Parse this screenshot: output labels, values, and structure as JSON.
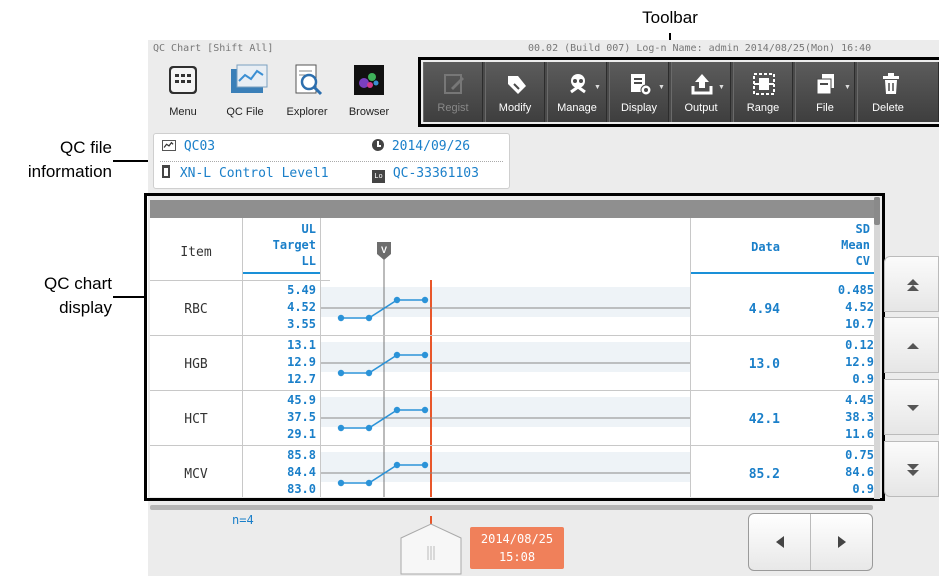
{
  "annotations": {
    "toolbar": "Toolbar",
    "qc_file_info_line1": "QC file",
    "qc_file_info_line2": "information",
    "qc_chart_line1": "QC chart",
    "qc_chart_line2": "display"
  },
  "titlebar": {
    "left": "QC Chart [Shift All]",
    "right": "00.02 (Build 007)  Log-n Name: admin   2014/08/25(Mon) 16:40"
  },
  "launch_buttons": [
    {
      "label": "Menu",
      "icon": "grid-menu-icon"
    },
    {
      "label": "QC File",
      "icon": "qc-file-icon"
    },
    {
      "label": "Explorer",
      "icon": "explorer-icon"
    },
    {
      "label": "Browser",
      "icon": "browser-icon"
    }
  ],
  "toolbar": [
    {
      "label": "Regist",
      "icon": "pencil-icon",
      "dropdown": false,
      "enabled": false
    },
    {
      "label": "Modify",
      "icon": "eraser-icon",
      "dropdown": false,
      "enabled": true
    },
    {
      "label": "Manage",
      "icon": "manage-icon",
      "dropdown": true,
      "enabled": true
    },
    {
      "label": "Display",
      "icon": "display-settings-icon",
      "dropdown": true,
      "enabled": true
    },
    {
      "label": "Output",
      "icon": "upload-icon",
      "dropdown": true,
      "enabled": true
    },
    {
      "label": "Range",
      "icon": "range-icon",
      "dropdown": false,
      "enabled": true
    },
    {
      "label": "File",
      "icon": "file-icon",
      "dropdown": true,
      "enabled": true
    },
    {
      "label": "Delete",
      "icon": "trash-icon",
      "dropdown": false,
      "enabled": true
    }
  ],
  "qc_info": {
    "file_name": "QC03",
    "date": "2014/09/26",
    "material": "XN-L Control Level1",
    "lot": "QC-33361103"
  },
  "table": {
    "header": {
      "item": "Item",
      "ul": "UL",
      "target": "Target",
      "ll": "LL",
      "marker": "V",
      "data": "Data",
      "sd": "SD",
      "mean": "Mean",
      "cv": "CV"
    },
    "rows": [
      {
        "item": "RBC",
        "ul": "5.49",
        "target": "4.52",
        "ll": "3.55",
        "data": "4.94",
        "sd": "0.485",
        "mean": "4.52",
        "cv": "10.7"
      },
      {
        "item": "HGB",
        "ul": "13.1",
        "target": "12.9",
        "ll": "12.7",
        "data": "13.0",
        "sd": "0.12",
        "mean": "12.9",
        "cv": "0.9"
      },
      {
        "item": "HCT",
        "ul": "45.9",
        "target": "37.5",
        "ll": "29.1",
        "data": "42.1",
        "sd": "4.45",
        "mean": "38.3",
        "cv": "11.6"
      },
      {
        "item": "MCV",
        "ul": "85.8",
        "target": "84.4",
        "ll": "83.0",
        "data": "85.2",
        "sd": "0.75",
        "mean": "84.6",
        "cv": "0.9"
      }
    ]
  },
  "bottom": {
    "count": "n=4",
    "date": "2014/08/25",
    "time": "15:08"
  },
  "colors": {
    "accent_blue": "#1a7fc9",
    "toolbar_bg": "#4a4a4a",
    "cursor_red": "#e8562a",
    "date_box": "#f0805a"
  }
}
